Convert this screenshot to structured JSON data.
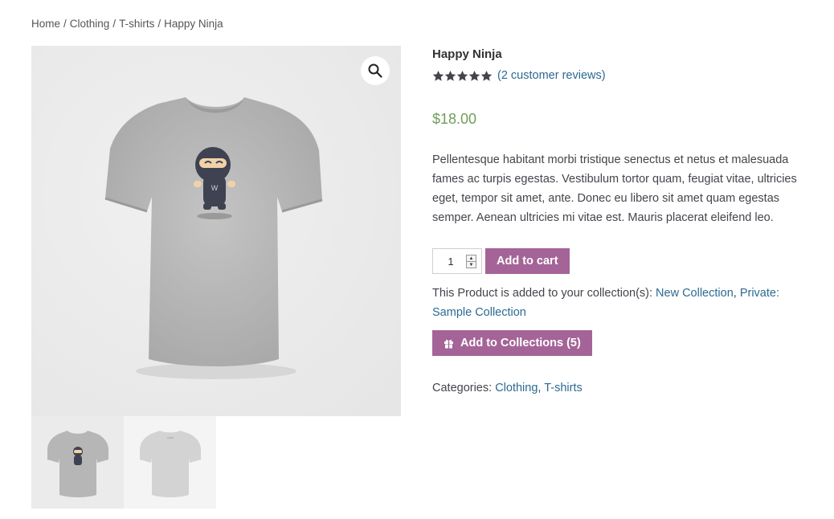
{
  "breadcrumb": {
    "home": "Home",
    "sep": "/",
    "clothing": "Clothing",
    "tshirts": "T-shirts",
    "current": "Happy Ninja"
  },
  "gallery": {
    "zoom_icon": "magnifier-icon",
    "thumbnails": [
      "front",
      "back"
    ]
  },
  "product": {
    "title": "Happy Ninja",
    "rating": 5,
    "rating_max": 5,
    "star_color": "#43454b",
    "reviews_link": "(2 customer reviews)",
    "price": "$18.00",
    "price_color": "#6e9e5a",
    "description": "Pellentesque habitant morbi tristique senectus et netus et malesuada fames ac turpis egestas. Vestibulum tortor quam, feugiat vitae, ultricies eget, tempor sit amet, ante. Donec eu libero sit amet quam egestas semper. Aenean ultricies mi vitae est. Mauris placerat eleifend leo."
  },
  "cart": {
    "quantity": "1",
    "add_to_cart": "Add to cart",
    "button_color": "#a46497"
  },
  "collections": {
    "note_prefix": "This Product is added to your collection(s):",
    "items": [
      "New Collection",
      "Private: Sample Collection"
    ],
    "comma": ",",
    "button_label": "Add to Collections (5)",
    "button_icon": "gift-icon"
  },
  "categories": {
    "label": "Categories:",
    "items": [
      "Clothing",
      "T-shirts"
    ],
    "comma": ","
  },
  "colors": {
    "link": "#2c6a91"
  }
}
